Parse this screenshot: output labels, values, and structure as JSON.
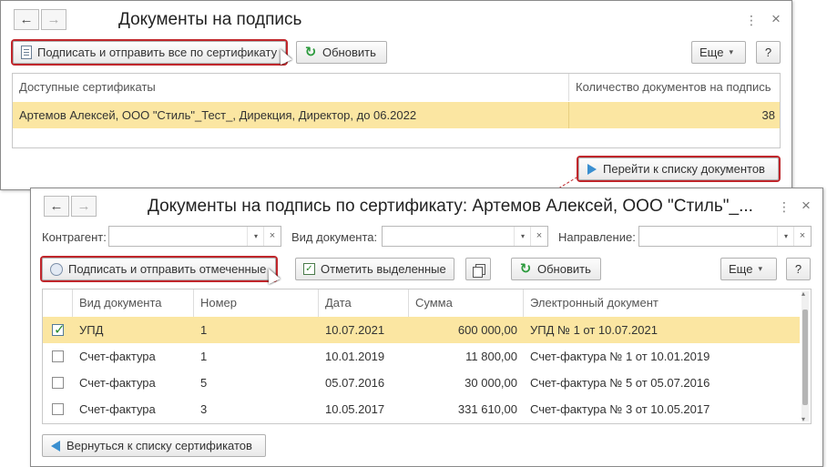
{
  "window1": {
    "title": "Документы на подпись",
    "sign_all_btn": "Подписать и отправить все по сертификату",
    "refresh_btn": "Обновить",
    "more_btn": "Еще",
    "help_btn": "?",
    "table": {
      "columns": [
        "Доступные сертификаты",
        "Количество документов на подпись"
      ],
      "rows": [
        {
          "certificate": "Артемов Алексей, ООО \"Стиль\"_Тест_, Дирекция, Директор, до 06.2022",
          "count": "38"
        }
      ]
    },
    "goto_docs_btn": "Перейти к списку документов"
  },
  "window2": {
    "title": "Документы на подпись по сертификату: Артемов Алексей, ООО \"Стиль\"_...",
    "filters": {
      "counterparty_label": "Контрагент:",
      "doctype_label": "Вид документа:",
      "direction_label": "Направление:"
    },
    "sign_selected_btn": "Подписать и отправить отмеченные",
    "mark_selected_btn": "Отметить выделенные",
    "refresh_btn": "Обновить",
    "more_btn": "Еще",
    "help_btn": "?",
    "table": {
      "columns": [
        "Вид документа",
        "Номер",
        "Дата",
        "Сумма",
        "Электронный документ"
      ],
      "rows": [
        {
          "checked": true,
          "doc_type": "УПД",
          "number": "1",
          "date": "10.07.2021",
          "sum": "600 000,00",
          "edoc": "УПД № 1 от 10.07.2021"
        },
        {
          "checked": false,
          "doc_type": "Счет-фактура",
          "number": "1",
          "date": "10.01.2019",
          "sum": "11 800,00",
          "edoc": "Счет-фактура № 1 от 10.01.2019"
        },
        {
          "checked": false,
          "doc_type": "Счет-фактура",
          "number": "5",
          "date": "05.07.2016",
          "sum": "30 000,00",
          "edoc": "Счет-фактура № 5 от 05.07.2016"
        },
        {
          "checked": false,
          "doc_type": "Счет-фактура",
          "number": "3",
          "date": "10.05.2017",
          "sum": "331 610,00",
          "edoc": "Счет-фактура № 3 от 10.05.2017"
        }
      ]
    },
    "back_btn": "Вернуться к списку сертификатов"
  },
  "icons": {
    "back": "←",
    "forward": "→",
    "more_menu": "⋮",
    "close": "×",
    "dropdown": "▾",
    "clear": "×",
    "scroll_up": "▴",
    "scroll_down": "▾"
  },
  "colors": {
    "highlight_border": "#c0262b",
    "selected_row": "#fbe6a2",
    "refresh_icon": "#2b9a3c",
    "arrow_icon": "#3a8fd0"
  }
}
